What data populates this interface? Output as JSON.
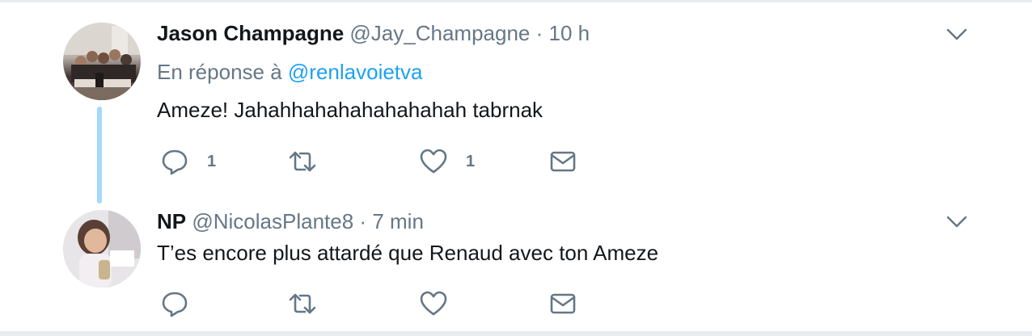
{
  "tweets": [
    {
      "fullname": "Jason Champagne",
      "username": "@Jay_Champagne",
      "separator": "·",
      "time": "10 h",
      "reply_prefix": "En réponse à",
      "reply_mention": "@renlavoietva",
      "text": "Ameze! Jahahhahahahahahahah tabrnak",
      "counts": {
        "reply": "1",
        "retweet": "",
        "like": "1"
      },
      "avatar_icon": "group-photo-avatar"
    },
    {
      "fullname": "NP",
      "username": "@NicolasPlante8",
      "separator": "·",
      "time": "7 min",
      "text": "T’es encore plus attardé que Renaud avec ton Ameze",
      "counts": {
        "reply": "",
        "retweet": "",
        "like": ""
      },
      "avatar_icon": "child-photo-avatar"
    }
  ],
  "icons": {
    "reply": "reply-icon",
    "retweet": "retweet-icon",
    "like": "heart-icon",
    "dm": "envelope-icon",
    "more": "chevron-down-icon"
  },
  "colors": {
    "text": "#14171a",
    "secondary": "#657786",
    "link": "#1da1f2",
    "thread_line": "#a4d9f9",
    "divider": "#e6ecf0"
  }
}
